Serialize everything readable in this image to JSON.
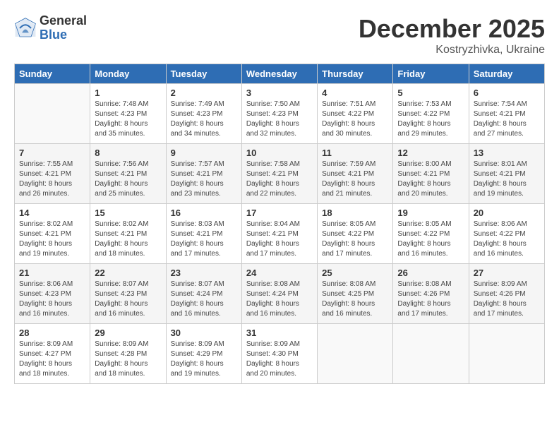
{
  "header": {
    "logo_general": "General",
    "logo_blue": "Blue",
    "month": "December 2025",
    "location": "Kostryzhivka, Ukraine"
  },
  "weekdays": [
    "Sunday",
    "Monday",
    "Tuesday",
    "Wednesday",
    "Thursday",
    "Friday",
    "Saturday"
  ],
  "weeks": [
    [
      {
        "day": "",
        "sunrise": "",
        "sunset": "",
        "daylight": ""
      },
      {
        "day": "1",
        "sunrise": "Sunrise: 7:48 AM",
        "sunset": "Sunset: 4:23 PM",
        "daylight": "Daylight: 8 hours and 35 minutes."
      },
      {
        "day": "2",
        "sunrise": "Sunrise: 7:49 AM",
        "sunset": "Sunset: 4:23 PM",
        "daylight": "Daylight: 8 hours and 34 minutes."
      },
      {
        "day": "3",
        "sunrise": "Sunrise: 7:50 AM",
        "sunset": "Sunset: 4:23 PM",
        "daylight": "Daylight: 8 hours and 32 minutes."
      },
      {
        "day": "4",
        "sunrise": "Sunrise: 7:51 AM",
        "sunset": "Sunset: 4:22 PM",
        "daylight": "Daylight: 8 hours and 30 minutes."
      },
      {
        "day": "5",
        "sunrise": "Sunrise: 7:53 AM",
        "sunset": "Sunset: 4:22 PM",
        "daylight": "Daylight: 8 hours and 29 minutes."
      },
      {
        "day": "6",
        "sunrise": "Sunrise: 7:54 AM",
        "sunset": "Sunset: 4:21 PM",
        "daylight": "Daylight: 8 hours and 27 minutes."
      }
    ],
    [
      {
        "day": "7",
        "sunrise": "Sunrise: 7:55 AM",
        "sunset": "Sunset: 4:21 PM",
        "daylight": "Daylight: 8 hours and 26 minutes."
      },
      {
        "day": "8",
        "sunrise": "Sunrise: 7:56 AM",
        "sunset": "Sunset: 4:21 PM",
        "daylight": "Daylight: 8 hours and 25 minutes."
      },
      {
        "day": "9",
        "sunrise": "Sunrise: 7:57 AM",
        "sunset": "Sunset: 4:21 PM",
        "daylight": "Daylight: 8 hours and 23 minutes."
      },
      {
        "day": "10",
        "sunrise": "Sunrise: 7:58 AM",
        "sunset": "Sunset: 4:21 PM",
        "daylight": "Daylight: 8 hours and 22 minutes."
      },
      {
        "day": "11",
        "sunrise": "Sunrise: 7:59 AM",
        "sunset": "Sunset: 4:21 PM",
        "daylight": "Daylight: 8 hours and 21 minutes."
      },
      {
        "day": "12",
        "sunrise": "Sunrise: 8:00 AM",
        "sunset": "Sunset: 4:21 PM",
        "daylight": "Daylight: 8 hours and 20 minutes."
      },
      {
        "day": "13",
        "sunrise": "Sunrise: 8:01 AM",
        "sunset": "Sunset: 4:21 PM",
        "daylight": "Daylight: 8 hours and 19 minutes."
      }
    ],
    [
      {
        "day": "14",
        "sunrise": "Sunrise: 8:02 AM",
        "sunset": "Sunset: 4:21 PM",
        "daylight": "Daylight: 8 hours and 19 minutes."
      },
      {
        "day": "15",
        "sunrise": "Sunrise: 8:02 AM",
        "sunset": "Sunset: 4:21 PM",
        "daylight": "Daylight: 8 hours and 18 minutes."
      },
      {
        "day": "16",
        "sunrise": "Sunrise: 8:03 AM",
        "sunset": "Sunset: 4:21 PM",
        "daylight": "Daylight: 8 hours and 17 minutes."
      },
      {
        "day": "17",
        "sunrise": "Sunrise: 8:04 AM",
        "sunset": "Sunset: 4:21 PM",
        "daylight": "Daylight: 8 hours and 17 minutes."
      },
      {
        "day": "18",
        "sunrise": "Sunrise: 8:05 AM",
        "sunset": "Sunset: 4:22 PM",
        "daylight": "Daylight: 8 hours and 17 minutes."
      },
      {
        "day": "19",
        "sunrise": "Sunrise: 8:05 AM",
        "sunset": "Sunset: 4:22 PM",
        "daylight": "Daylight: 8 hours and 16 minutes."
      },
      {
        "day": "20",
        "sunrise": "Sunrise: 8:06 AM",
        "sunset": "Sunset: 4:22 PM",
        "daylight": "Daylight: 8 hours and 16 minutes."
      }
    ],
    [
      {
        "day": "21",
        "sunrise": "Sunrise: 8:06 AM",
        "sunset": "Sunset: 4:23 PM",
        "daylight": "Daylight: 8 hours and 16 minutes."
      },
      {
        "day": "22",
        "sunrise": "Sunrise: 8:07 AM",
        "sunset": "Sunset: 4:23 PM",
        "daylight": "Daylight: 8 hours and 16 minutes."
      },
      {
        "day": "23",
        "sunrise": "Sunrise: 8:07 AM",
        "sunset": "Sunset: 4:24 PM",
        "daylight": "Daylight: 8 hours and 16 minutes."
      },
      {
        "day": "24",
        "sunrise": "Sunrise: 8:08 AM",
        "sunset": "Sunset: 4:24 PM",
        "daylight": "Daylight: 8 hours and 16 minutes."
      },
      {
        "day": "25",
        "sunrise": "Sunrise: 8:08 AM",
        "sunset": "Sunset: 4:25 PM",
        "daylight": "Daylight: 8 hours and 16 minutes."
      },
      {
        "day": "26",
        "sunrise": "Sunrise: 8:08 AM",
        "sunset": "Sunset: 4:26 PM",
        "daylight": "Daylight: 8 hours and 17 minutes."
      },
      {
        "day": "27",
        "sunrise": "Sunrise: 8:09 AM",
        "sunset": "Sunset: 4:26 PM",
        "daylight": "Daylight: 8 hours and 17 minutes."
      }
    ],
    [
      {
        "day": "28",
        "sunrise": "Sunrise: 8:09 AM",
        "sunset": "Sunset: 4:27 PM",
        "daylight": "Daylight: 8 hours and 18 minutes."
      },
      {
        "day": "29",
        "sunrise": "Sunrise: 8:09 AM",
        "sunset": "Sunset: 4:28 PM",
        "daylight": "Daylight: 8 hours and 18 minutes."
      },
      {
        "day": "30",
        "sunrise": "Sunrise: 8:09 AM",
        "sunset": "Sunset: 4:29 PM",
        "daylight": "Daylight: 8 hours and 19 minutes."
      },
      {
        "day": "31",
        "sunrise": "Sunrise: 8:09 AM",
        "sunset": "Sunset: 4:30 PM",
        "daylight": "Daylight: 8 hours and 20 minutes."
      },
      {
        "day": "",
        "sunrise": "",
        "sunset": "",
        "daylight": ""
      },
      {
        "day": "",
        "sunrise": "",
        "sunset": "",
        "daylight": ""
      },
      {
        "day": "",
        "sunrise": "",
        "sunset": "",
        "daylight": ""
      }
    ]
  ]
}
